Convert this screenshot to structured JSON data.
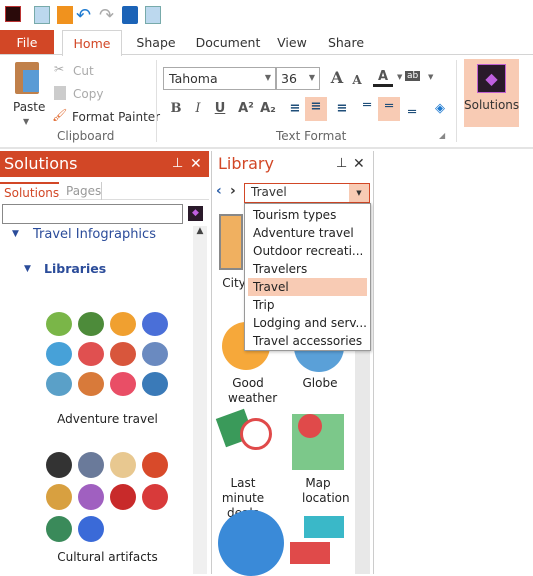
{
  "quick_access": {
    "icons": [
      "app-icon",
      "new-icon",
      "open-icon",
      "undo-icon",
      "redo-icon",
      "save-icon",
      "print-preview-icon"
    ]
  },
  "tabs": {
    "file": "File",
    "home": "Home",
    "shape": "Shape",
    "document": "Document",
    "view": "View",
    "share": "Share"
  },
  "clipboard": {
    "paste": "Paste",
    "cut": "Cut",
    "copy": "Copy",
    "format_painter": "Format Painter",
    "group": "Clipboard"
  },
  "text_format": {
    "font": "Tahoma",
    "size": "36",
    "group": "Text Format",
    "bold": "B",
    "italic": "I",
    "underline": "U",
    "font_color": "A",
    "highlight": "ab"
  },
  "solutions_btn": "Solutions",
  "solutions_panel": {
    "title": "Solutions",
    "tabs": [
      "Solutions",
      "Pages"
    ],
    "search_value": "",
    "tree": {
      "root": "Travel Infographics",
      "child": "Libraries"
    },
    "libraries": [
      "Adventure travel",
      "Cultural artifacts"
    ]
  },
  "library_panel": {
    "title": "Library",
    "selected": "Travel",
    "options": [
      "Tourism types",
      "Adventure travel",
      "Outdoor recreati...",
      "Travelers",
      "Travel",
      "Trip",
      "Lodging and serv...",
      "Travel accessories"
    ],
    "items": [
      "City",
      "Good weather",
      "Globe",
      "Last minute deals",
      "Map location"
    ]
  },
  "colors": {
    "accent": "#d24726",
    "highlight": "#f8cbb4"
  }
}
